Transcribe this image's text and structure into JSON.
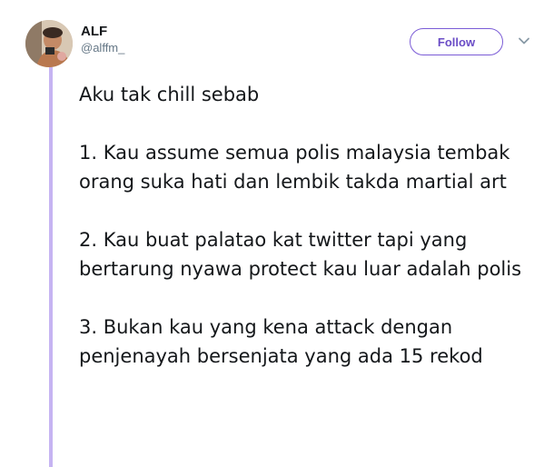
{
  "author": {
    "display_name": "ALF",
    "handle": "@alffm_"
  },
  "actions": {
    "follow_label": "Follow"
  },
  "icons": {
    "menu": "chevron-down-icon"
  },
  "colors": {
    "accent": "#7b5cd6",
    "thread_line": "#c6b4f2",
    "text": "#14171a",
    "secondary_text": "#657786"
  },
  "tweet": {
    "paragraphs": [
      "Aku tak chill sebab",
      "1. Kau assume semua polis malaysia tembak orang suka hati dan lembik takda martial art",
      "2. Kau buat palatao kat twitter tapi yang bertarung nyawa protect kau luar adalah polis",
      "3. Bukan kau yang kena attack dengan penjenayah bersenjata yang ada 15 rekod"
    ]
  }
}
